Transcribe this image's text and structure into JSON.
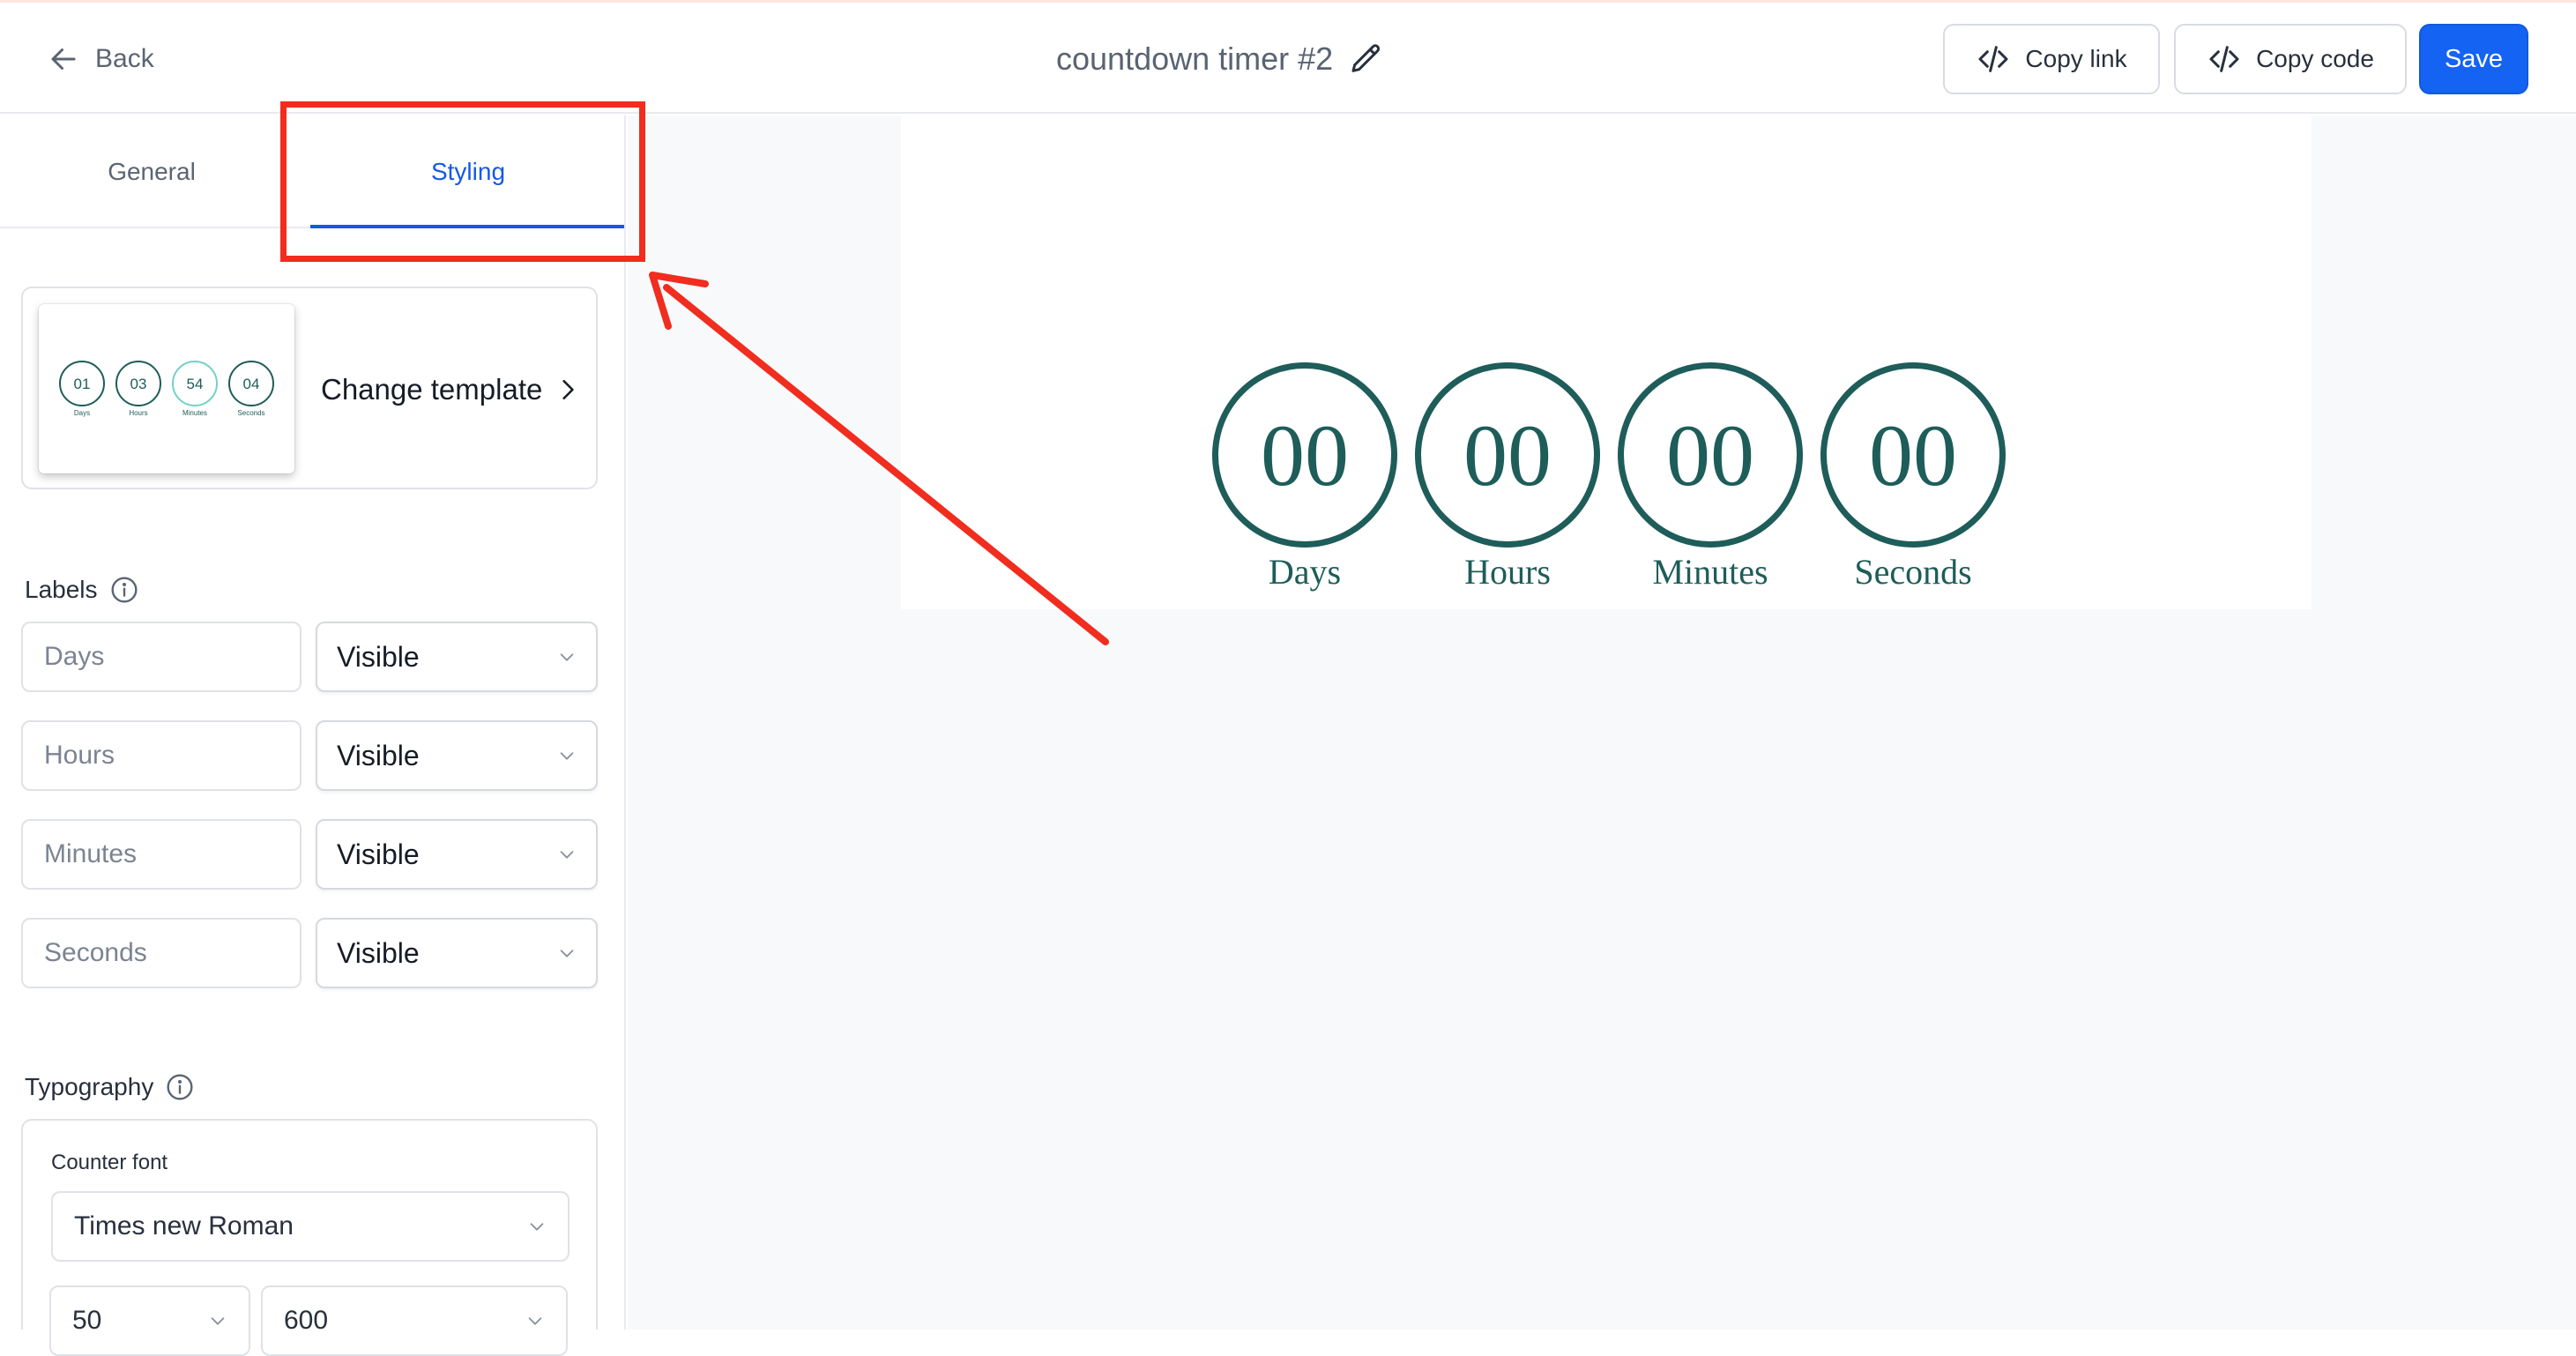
{
  "header": {
    "back_label": "Back",
    "title": "countdown timer #2",
    "copy_link_label": "Copy link",
    "copy_code_label": "Copy code",
    "save_label": "Save"
  },
  "tabs": {
    "general": "General",
    "styling": "Styling",
    "active": "Styling"
  },
  "template": {
    "change_label": "Change template",
    "thumbnail": {
      "values": [
        "01",
        "03",
        "54",
        "04"
      ],
      "labels": [
        "Days",
        "Hours",
        "Minutes",
        "Seconds"
      ]
    }
  },
  "labels_section": {
    "title": "Labels",
    "rows": [
      {
        "name": "Days",
        "visibility": "Visible"
      },
      {
        "name": "Hours",
        "visibility": "Visible"
      },
      {
        "name": "Minutes",
        "visibility": "Visible"
      },
      {
        "name": "Seconds",
        "visibility": "Visible"
      }
    ]
  },
  "typography": {
    "title": "Typography",
    "counter_font_label": "Counter font",
    "counter_font": "Times new Roman",
    "font_size": "50",
    "font_weight": "600"
  },
  "preview": {
    "units": [
      {
        "value": "00",
        "label": "Days"
      },
      {
        "value": "00",
        "label": "Hours"
      },
      {
        "value": "00",
        "label": "Minutes"
      },
      {
        "value": "00",
        "label": "Seconds"
      }
    ]
  },
  "colors": {
    "accent": "#1463f3",
    "timer": "#1e5d59",
    "annotation": "#f02d1e"
  }
}
